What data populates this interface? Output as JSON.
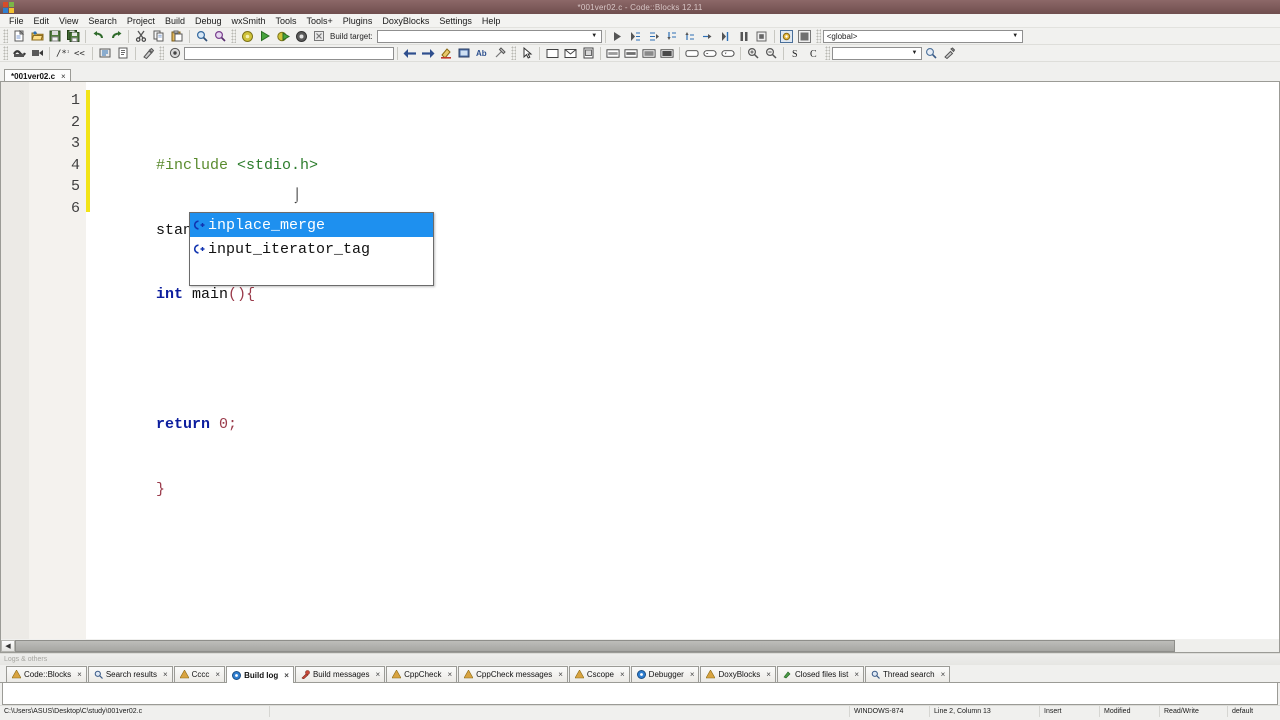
{
  "window": {
    "title": "*001ver02.c - Code::Blocks 12.11",
    "sysicon_name": "codeblocks-logo-icon"
  },
  "menubar": {
    "items": [
      {
        "label": "File"
      },
      {
        "label": "Edit"
      },
      {
        "label": "View"
      },
      {
        "label": "Search"
      },
      {
        "label": "Project"
      },
      {
        "label": "Build"
      },
      {
        "label": "Debug"
      },
      {
        "label": "wxSmith"
      },
      {
        "label": "Tools"
      },
      {
        "label": "Tools+"
      },
      {
        "label": "Plugins"
      },
      {
        "label": "DoxyBlocks"
      },
      {
        "label": "Settings"
      },
      {
        "label": "Help"
      }
    ]
  },
  "toolbar_main": {
    "build_target_label": "Build target:",
    "build_target_value": "",
    "scope_value": "<global>",
    "buttons": [
      {
        "name": "new-file-button"
      },
      {
        "name": "open-file-button"
      },
      {
        "name": "save-button"
      },
      {
        "name": "save-all-button"
      },
      {
        "name": "undo-button"
      },
      {
        "name": "redo-button"
      },
      {
        "name": "cut-button"
      },
      {
        "name": "copy-button"
      },
      {
        "name": "paste-button"
      },
      {
        "name": "find-button"
      },
      {
        "name": "replace-button"
      },
      {
        "name": "build-button"
      },
      {
        "name": "run-button"
      },
      {
        "name": "build-and-run-button"
      },
      {
        "name": "rebuild-button"
      },
      {
        "name": "abort-button"
      }
    ],
    "debug_buttons": [
      {
        "name": "debug-continue-button"
      },
      {
        "name": "debug-run-to-cursor-button"
      },
      {
        "name": "debug-next-line-button"
      },
      {
        "name": "debug-step-into-button"
      },
      {
        "name": "debug-step-out-button"
      },
      {
        "name": "debug-next-instruction-button"
      },
      {
        "name": "debug-step-instruction-button"
      },
      {
        "name": "debug-break-button"
      },
      {
        "name": "debug-stop-button"
      },
      {
        "name": "debugging-windows-button"
      },
      {
        "name": "various-info-button"
      }
    ]
  },
  "toolbar_second": {
    "doxy_value": "",
    "search_value": "",
    "buttons": [
      {
        "name": "doxyblocks-extract-button"
      },
      {
        "name": "doxyblocks-comment-button"
      },
      {
        "name": "doxyblocks-block-comment-button"
      },
      {
        "name": "doxyblocks-line-comment-button"
      },
      {
        "name": "doxyblocks-run-html-button"
      },
      {
        "name": "doxyblocks-run-chm-button"
      },
      {
        "name": "doxyblocks-config-button"
      },
      {
        "name": "cscope-button"
      },
      {
        "name": "nav-back-button"
      },
      {
        "name": "nav-forward-button"
      },
      {
        "name": "highlight-button"
      },
      {
        "name": "thread-search-button"
      },
      {
        "name": "translate-button"
      },
      {
        "name": "clear-button"
      },
      {
        "name": "wxsmith-pointer-button"
      },
      {
        "name": "wxsmith-panel-button"
      },
      {
        "name": "wxsmith-dialog-button"
      },
      {
        "name": "wxsmith-frame-button"
      },
      {
        "name": "wxsmith-row-button"
      },
      {
        "name": "wxsmith-col-button"
      },
      {
        "name": "wxsmith-grid-button"
      },
      {
        "name": "wxsmith-box-button"
      },
      {
        "name": "wxsmith-button-button"
      },
      {
        "name": "wxsmith-textctrl-button"
      },
      {
        "name": "wxsmith-combo-button"
      },
      {
        "name": "zoom-in-button"
      },
      {
        "name": "zoom-out-button"
      },
      {
        "name": "spell-check-button"
      },
      {
        "name": "camel-case-button"
      },
      {
        "name": "symbols-browser-button"
      },
      {
        "name": "tools-button"
      }
    ]
  },
  "editor": {
    "tab_label": "*001ver02.c",
    "tab_close": "×",
    "lines": [
      {
        "num": "1",
        "tokens": [
          {
            "text": "#include",
            "cls": "c-pre"
          },
          {
            "text": " ",
            "cls": "c-plain"
          },
          {
            "text": "<stdio.h>",
            "cls": "c-str"
          }
        ]
      },
      {
        "num": "2",
        "tokens": [
          {
            "text": "standard inp",
            "cls": "c-plain"
          }
        ],
        "caret": true
      },
      {
        "num": "3",
        "tokens": [
          {
            "text": "int",
            "cls": "c-kw"
          },
          {
            "text": " main",
            "cls": "c-plain"
          },
          {
            "text": "()",
            "cls": "c-br"
          },
          {
            "text": "{",
            "cls": "c-br"
          }
        ]
      },
      {
        "num": "4",
        "tokens": []
      },
      {
        "num": "5",
        "tokens": [
          {
            "text": "return",
            "cls": "c-kw"
          },
          {
            "text": " ",
            "cls": "c-plain"
          },
          {
            "text": "0;",
            "cls": "c-br"
          }
        ]
      },
      {
        "num": "6",
        "tokens": [
          {
            "text": "}",
            "cls": "c-br"
          }
        ]
      }
    ]
  },
  "autocomplete": {
    "items": [
      {
        "icon": "cpp-symbol-icon",
        "icon_glyph": "€•",
        "label": "inplace_merge",
        "selected": true
      },
      {
        "icon": "cpp-symbol-icon",
        "icon_glyph": "€•",
        "label": "input_iterator_tag",
        "selected": false
      }
    ]
  },
  "logs": {
    "caption": "Logs & others",
    "tabs": [
      {
        "label": "Code::Blocks",
        "icon": "codeblocks-tab-icon",
        "active": false
      },
      {
        "label": "Search results",
        "icon": "magnifier-icon",
        "active": false
      },
      {
        "label": "Cccc",
        "icon": "codeblocks-tab-icon",
        "active": false
      },
      {
        "label": "Build log",
        "icon": "gear-blue-icon",
        "active": true
      },
      {
        "label": "Build messages",
        "icon": "wrench-icon",
        "active": false
      },
      {
        "label": "CppCheck",
        "icon": "codeblocks-tab-icon",
        "active": false
      },
      {
        "label": "CppCheck messages",
        "icon": "codeblocks-tab-icon",
        "active": false
      },
      {
        "label": "Cscope",
        "icon": "codeblocks-tab-icon",
        "active": false
      },
      {
        "label": "Debugger",
        "icon": "gear-blue-icon",
        "active": false
      },
      {
        "label": "DoxyBlocks",
        "icon": "codeblocks-tab-icon",
        "active": false
      },
      {
        "label": "Closed files list",
        "icon": "files-icon",
        "active": false
      },
      {
        "label": "Thread search",
        "icon": "magnifier-icon",
        "active": false
      }
    ],
    "close_glyph": "×"
  },
  "statusbar": {
    "path": "C:\\Users\\ASUS\\Desktop\\C\\study\\001ver02.c",
    "blank": "",
    "encoding": "WINDOWS-874",
    "position": "Line 2, Column 13",
    "insert_mode": "Insert",
    "modified": "Modified",
    "readwrite": "Read/Write",
    "profile": "default"
  },
  "colors": {
    "titlebar": "#7b5858",
    "accent_selection": "#1e90ef",
    "change_marker": "#f2e416",
    "keyword": "#0c1e9e",
    "preprocessor": "#5a8b2e",
    "string": "#2d7d2d",
    "bracket": "#9a3a4a"
  }
}
